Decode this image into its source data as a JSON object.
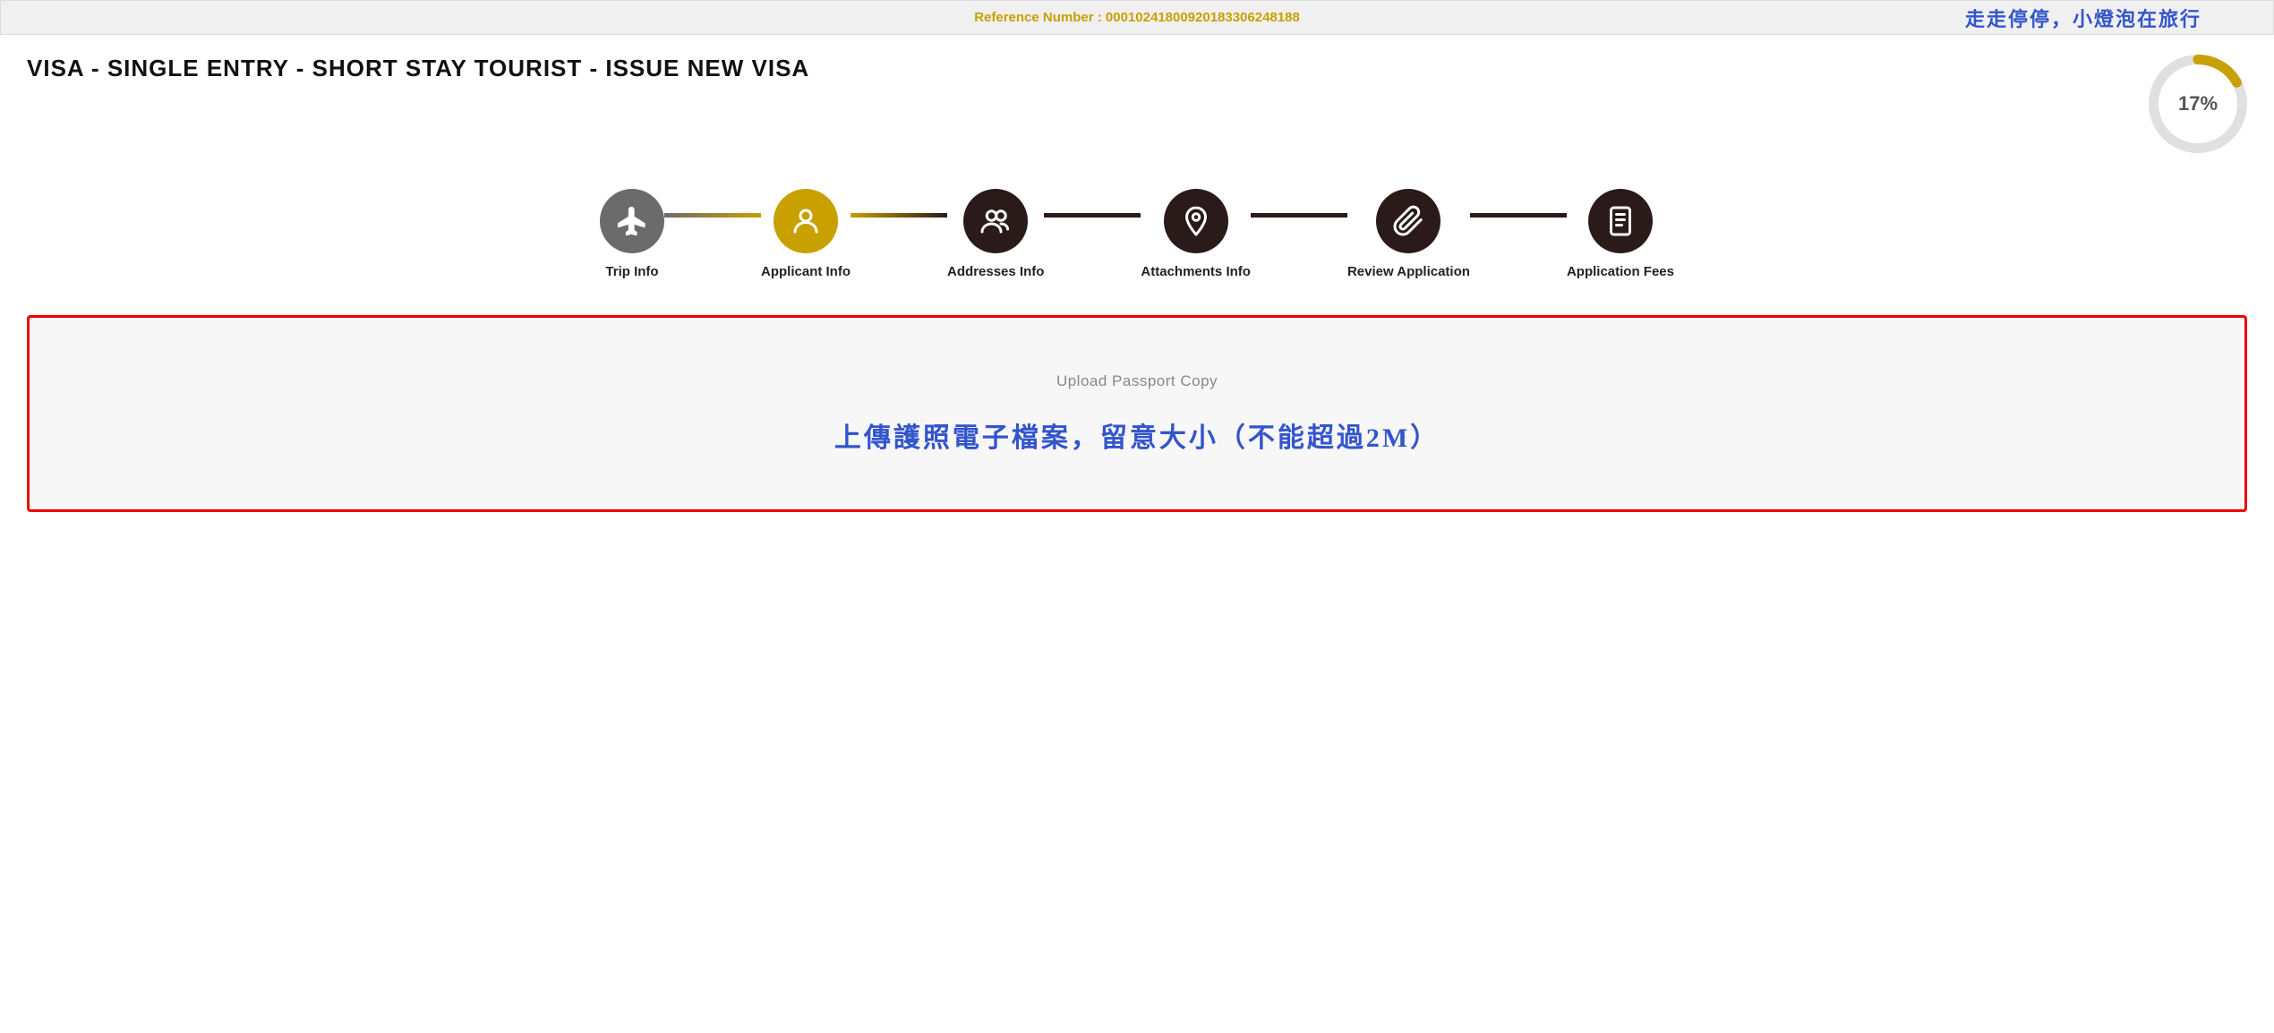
{
  "reference_bar": {
    "label": "Reference Number : 00010241800920183306248188",
    "watermark": "走走停停，小燈泡在旅行"
  },
  "header": {
    "title": "VISA - SINGLE ENTRY - SHORT STAY TOURIST - ISSUE NEW VISA"
  },
  "progress": {
    "percent_label": "17%",
    "percent_value": 17,
    "circumference": 283,
    "offset": 235
  },
  "stepper": {
    "steps": [
      {
        "id": "trip-info",
        "label": "Trip Info",
        "state": "completed",
        "icon": "plane"
      },
      {
        "id": "applicant-info",
        "label": "Applicant Info",
        "state": "active",
        "icon": "person"
      },
      {
        "id": "addresses-info",
        "label": "Addresses Info",
        "state": "inactive",
        "icon": "group"
      },
      {
        "id": "attachments-info",
        "label": "Attachments Info",
        "state": "inactive",
        "icon": "location"
      },
      {
        "id": "review-application",
        "label": "Review Application",
        "state": "inactive",
        "icon": "paperclip"
      },
      {
        "id": "application-fees",
        "label": "Application Fees",
        "state": "inactive",
        "icon": "document"
      }
    ],
    "connectors": [
      {
        "id": "conn-1",
        "type": "completed"
      },
      {
        "id": "conn-2",
        "type": "active-to-inactive"
      },
      {
        "id": "conn-3",
        "type": "inactive"
      },
      {
        "id": "conn-4",
        "type": "inactive"
      },
      {
        "id": "conn-5",
        "type": "inactive"
      }
    ]
  },
  "upload_section": {
    "main_text": "Upload Passport Copy",
    "annotation": "上傳護照電子檔案，留意大小（不能超過2M）"
  }
}
